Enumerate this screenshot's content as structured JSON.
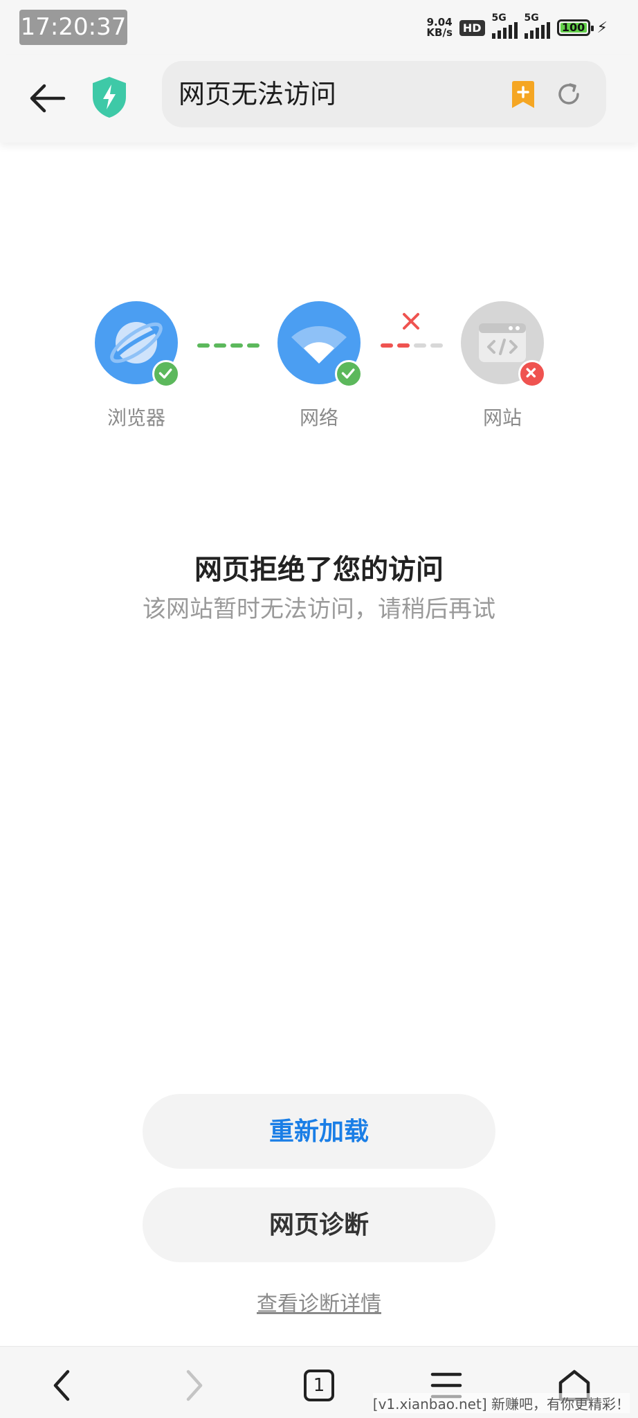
{
  "status_bar": {
    "time": "17:20:37",
    "net_speed_value": "9.04",
    "net_speed_unit": "KB/s",
    "hd_label": "HD",
    "signal1_label": "5G",
    "signal2_label": "5G",
    "battery": "100"
  },
  "toolbar": {
    "page_title": "网页无法访问"
  },
  "diagram": {
    "browser_label": "浏览器",
    "network_label": "网络",
    "website_label": "网站"
  },
  "message": {
    "title": "网页拒绝了您的访问",
    "subtitle": "该网站暂时无法访问，请稍后再试"
  },
  "actions": {
    "reload": "重新加载",
    "diagnose": "网页诊断",
    "details_link": "查看诊断详情"
  },
  "bottom_nav": {
    "tab_count": "1"
  },
  "watermark": "[v1.xianbao.net] 新赚吧，有你更精彩！",
  "colors": {
    "accent_blue": "#1a7ee6",
    "node_blue": "#4b9ef2",
    "ok_green": "#5cb85c",
    "error_red": "#ef5350",
    "bookmark_orange": "#f5a623",
    "shield_teal": "#3ec9a7"
  }
}
